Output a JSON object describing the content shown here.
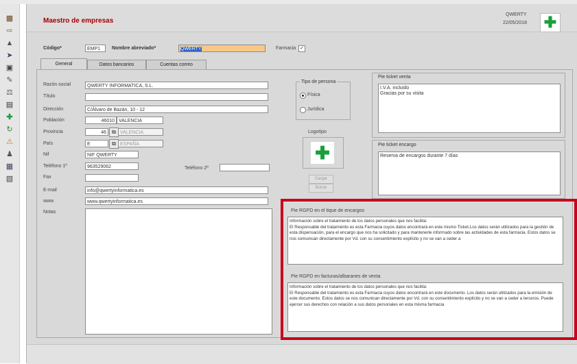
{
  "window": {
    "title": "Maestro de empresas",
    "user": "QWERTY",
    "date": "22/05/2018"
  },
  "header": {
    "codigo_label": "Código*",
    "codigo_value": "EMP1",
    "nombre_label": "Nombre abreviado*",
    "nombre_value": "QWERTY",
    "farmacia_label": "Farmacia"
  },
  "tabs": [
    "General",
    "Datos bancarios",
    "Cuentas correo"
  ],
  "form": {
    "razon_social": {
      "label": "Razón social",
      "value": "QWERTY INFORMATICA, S.L."
    },
    "titulo": {
      "label": "Título",
      "value": ""
    },
    "direccion": {
      "label": "Dirección",
      "value": "C/Álvaro de Bazán, 10 - 12"
    },
    "poblacion": {
      "label": "Población",
      "cp": "46010",
      "value": "VALENCIA"
    },
    "provincia": {
      "label": "Provincia",
      "code": "46",
      "value": "VALENCIA"
    },
    "pais": {
      "label": "País",
      "code": "E",
      "value": "ESPAÑA"
    },
    "nif": {
      "label": "Nif",
      "value": "NIF QWERTY"
    },
    "telefono1": {
      "label": "Teléfono 1º",
      "value": "963529062"
    },
    "telefono2": {
      "label": "Teléfono 2º",
      "value": ""
    },
    "fax": {
      "label": "Fax",
      "value": ""
    },
    "email": {
      "label": "E-mail",
      "value": "info@qwertyinformatica.es"
    },
    "www": {
      "label": "www",
      "value": "www.qwertyinformatica.es"
    },
    "notas": {
      "label": "Notas",
      "value": ""
    }
  },
  "tipo_persona": {
    "title": "Tipo de persona",
    "options": [
      "Física",
      "Jurídica"
    ],
    "selected": "Física"
  },
  "logotipo": {
    "title": "Logotipo",
    "cargar": "Cargar",
    "borrar": "Borrar"
  },
  "pie_ticket_venta": {
    "title": "Pie ticket venta",
    "text": "I.V.A. incluido\nGracias por su visita"
  },
  "pie_ticket_encargo": {
    "title": "Pie ticket encargo",
    "text": "Reserva de encargos durante 7 días"
  },
  "pie_rgpd_encargos": {
    "title": "Pie RGPD en el tique de encargos",
    "text": "Información sobre el tratamiento de los datos personales que nos facilita:\nEl Responsable del tratamiento es esta Farmacia cuyos datos encontrará en este mismo Ticket.Los datos serán utilizados para la gestión de esta dispensación, para el encargo que nos ha solicitado y para mantenerle informado sobre las actividades de esta farmacia. Estos datos se nos comunican directamente por Vd. con su consentimiento explícito y no se van a ceder a"
  },
  "pie_rgpd_facturas": {
    "title": "Pie RGPD en facturas/albaranes de venta",
    "text": "Información sobre el tratamiento de los datos personales que nos facilita:\nEl Responsable del tratamiento es esta Farmacia cuyos datos encontrará en este documento. Los datos serán utilizados para la emisión de este documento. Estos datos se nos comunican directamente por Vd. con su consentimiento explícito y no se van a ceder a terceros. Puede ejercer sus derechos con relación a sus datos personales en esta misma farmacia"
  },
  "toolbar_icons": [
    "printer-icon",
    "arrow-icon",
    "bell-icon",
    "cart-icon",
    "truck-icon",
    "pen-icon",
    "scale-icon",
    "monitor-icon",
    "pharmacy-cross-icon",
    "refresh-icon",
    "warning-icon",
    "user-icon",
    "chart-icon",
    "calendar-icon"
  ],
  "colors": {
    "title": "#a40000",
    "highlight": "#c8001e",
    "cross": "#1a9e3a",
    "field_hl": "#f7c889"
  }
}
